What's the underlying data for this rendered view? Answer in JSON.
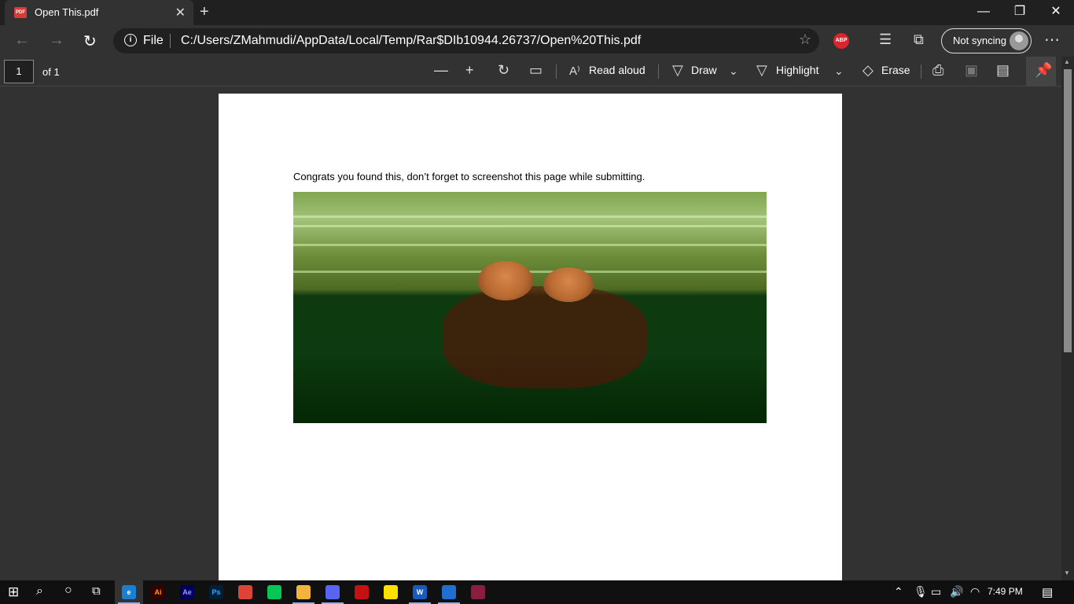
{
  "browser": {
    "tab_title": "Open This.pdf",
    "tab_icon_text": "PDF",
    "file_label": "File",
    "url": "C:/Users/ZMahmudi/AppData/Local/Temp/Rar$DIb10944.26737/Open%20This.pdf",
    "abp_label": "ABP",
    "sync_label": "Not syncing"
  },
  "pdf_toolbar": {
    "page_number": "1",
    "page_total": "of 1",
    "read_aloud": "Read aloud",
    "draw": "Draw",
    "highlight": "Highlight",
    "erase": "Erase"
  },
  "document": {
    "text": "Congrats you found this, don’t forget to screenshot this page while submitting."
  },
  "taskbar": {
    "time": "7:49 PM",
    "apps": [
      {
        "name": "edge",
        "label": "e",
        "color": "#1a7fd4"
      },
      {
        "name": "illustrator",
        "label": "Ai",
        "color": "#330000"
      },
      {
        "name": "after-effects",
        "label": "Ae",
        "color": "#00005b"
      },
      {
        "name": "photoshop",
        "label": "Ps",
        "color": "#001e36"
      },
      {
        "name": "chrome",
        "label": "",
        "color": "#db4437"
      },
      {
        "name": "line",
        "label": "",
        "color": "#06c755"
      },
      {
        "name": "file-explorer",
        "label": "",
        "color": "#f3b43d"
      },
      {
        "name": "discord",
        "label": "",
        "color": "#5865f2"
      },
      {
        "name": "among-us",
        "label": "",
        "color": "#c51111"
      },
      {
        "name": "sticky-notes",
        "label": "",
        "color": "#fce100"
      },
      {
        "name": "word",
        "label": "W",
        "color": "#185abd"
      },
      {
        "name": "vegas",
        "label": "",
        "color": "#1e6fcf"
      },
      {
        "name": "winrar",
        "label": "",
        "color": "#8b1e3f"
      }
    ]
  }
}
